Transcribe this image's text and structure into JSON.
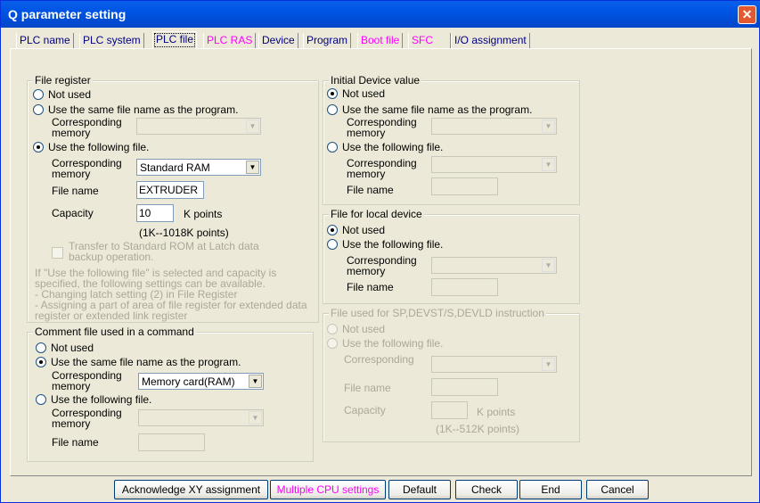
{
  "window": {
    "title": "Q parameter setting",
    "close": "✕"
  },
  "tabs": [
    "PLC name",
    "PLC system",
    "PLC file",
    "PLC RAS",
    "Device",
    "Program",
    "Boot file",
    "SFC",
    "I/O assignment"
  ],
  "file_register": {
    "legend": "File register",
    "not_used": "Not used",
    "same_name": "Use the same file name as the program.",
    "corr_memory": "Corresponding memory",
    "use_following": "Use the following file.",
    "memory_value": "Standard RAM",
    "file_name_label": "File name",
    "file_name": "EXTRUDER",
    "capacity_label": "Capacity",
    "capacity": "10",
    "k_points": "K points",
    "range": "(1K--1018K points)",
    "transfer": "Transfer to Standard ROM at Latch data backup operation.",
    "note": "If \"Use the following file\" is selected and capacity is specified, the following settings can be available.\n- Changing latch setting (2) in File Register\n- Assigning a part of area of file register for extended data register or extended link register"
  },
  "comment_file": {
    "legend": "Comment file used in a command",
    "not_used": "Not used",
    "same_name": "Use the same file name as the program.",
    "corr_memory": "Corresponding memory",
    "memory_value": "Memory card(RAM)",
    "use_following": "Use the following file.",
    "file_name_label": "File name"
  },
  "initial_device": {
    "legend": "Initial Device value",
    "not_used": "Not used",
    "same_name": "Use the same file name as the program.",
    "corr_memory": "Corresponding memory",
    "use_following": "Use the following file.",
    "file_name_label": "File name"
  },
  "local_device": {
    "legend": "File for local device",
    "not_used": "Not used",
    "use_following": "Use the following file.",
    "corr_memory": "Corresponding memory",
    "file_name_label": "File name"
  },
  "sp_devst": {
    "legend": "File used for SP,DEVST/S,DEVLD instruction",
    "not_used": "Not used",
    "use_following": "Use the following file.",
    "corr_memory": "Corresponding",
    "file_name_label": "File name",
    "capacity_label": "Capacity",
    "k_points": "K points",
    "range": "(1K--512K points)"
  },
  "buttons": {
    "ack_xy": "Acknowledge XY assignment",
    "multi_cpu": "Multiple CPU settings",
    "default": "Default",
    "check": "Check",
    "end": "End",
    "cancel": "Cancel"
  },
  "icons": {
    "dropdown": "▼"
  }
}
